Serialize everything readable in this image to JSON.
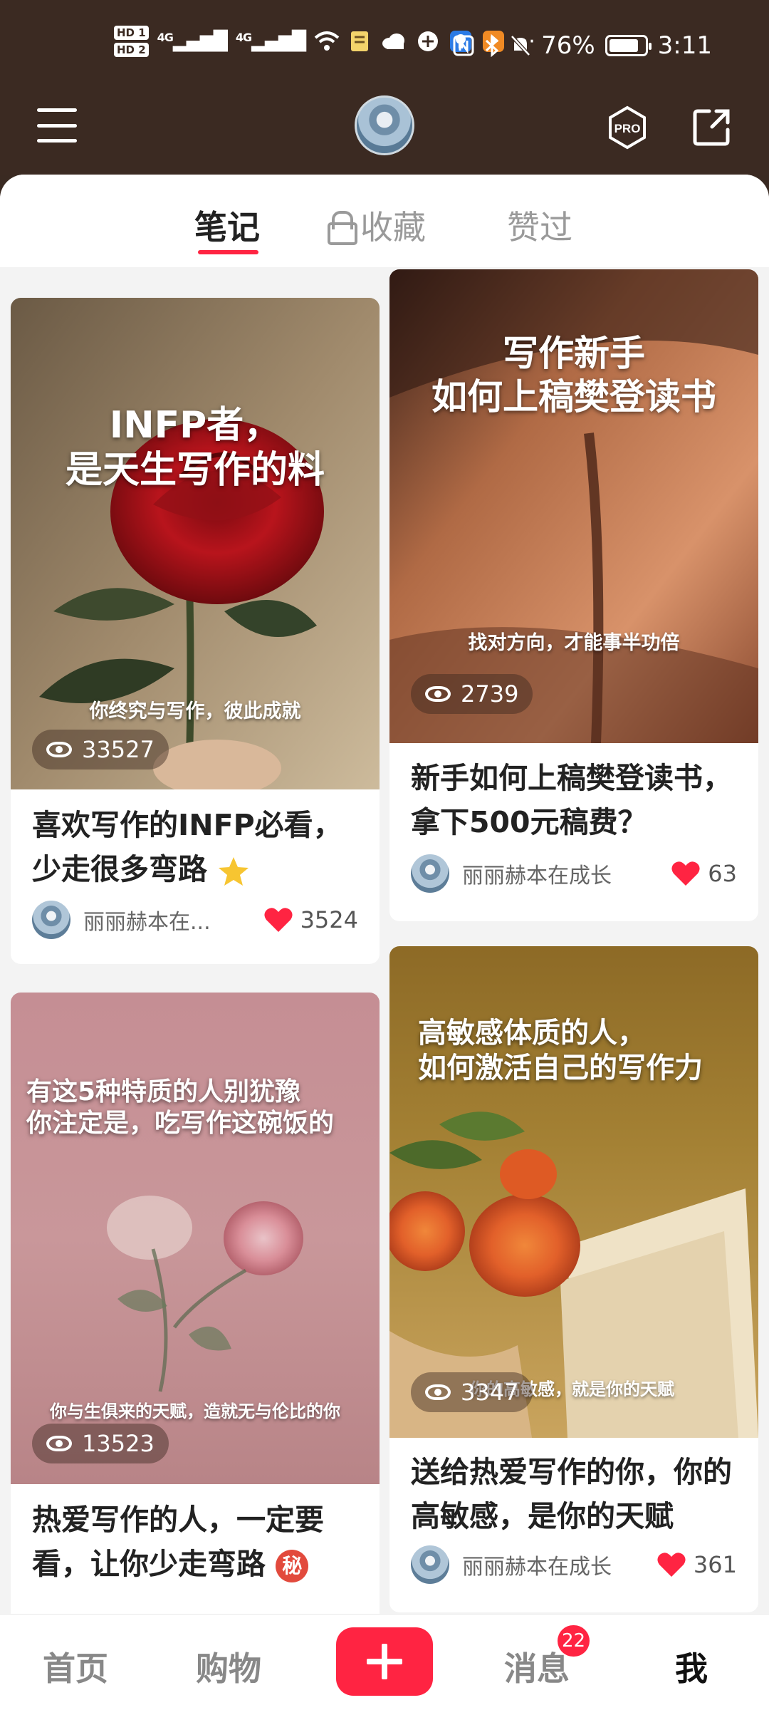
{
  "status_bar": {
    "hd1": "HD 1",
    "hd2": "HD 2",
    "signal1": "4G",
    "signal2": "4G",
    "dots": "···",
    "battery": "76%",
    "time": "3:11"
  },
  "header": {
    "pro_label": "PRO"
  },
  "tabs": [
    {
      "label": "笔记"
    },
    {
      "label": "收藏"
    },
    {
      "label": "赞过"
    }
  ],
  "notes": [
    {
      "cover_title": "INFP者，\n是天生写作的料",
      "cover_sub": "你终究与写作，彼此成就",
      "views": "33527",
      "title": "喜欢写作的INFP必看，少走很多弯路",
      "author": "丽丽赫本在...",
      "likes": "3524"
    },
    {
      "cover_title": "写作新手\n如何上稿樊登读书",
      "cover_sub": "找对方向，才能事半功倍",
      "views": "2739",
      "title": "新手如何上稿樊登读书，拿下500元稿费？",
      "author": "丽丽赫本在成长",
      "likes": "63"
    },
    {
      "cover_title": "有这5种特质的人别犹豫\n你注定是，吃写作这碗饭的",
      "cover_sub": "你与生俱来的天赋，造就无与伦比的你",
      "views": "13523",
      "title": "热爱写作的人，一定要看，让你少走弯路",
      "badge": "秘"
    },
    {
      "cover_title": "高敏感体质的人，\n如何激活自己的写作力",
      "cover_sub": "你的高敏感，就是你的天赋",
      "views": "3347",
      "title": "送给热爱写作的你，你的高敏感，是你的天赋",
      "author": "丽丽赫本在成长",
      "likes": "361"
    }
  ],
  "bottom_nav": [
    {
      "label": "首页"
    },
    {
      "label": "购物"
    },
    {
      "label": "消息",
      "badge": "22"
    },
    {
      "label": "我"
    }
  ],
  "colors": {
    "brand_red": "#ff2442",
    "header_bg": "#3b2a22"
  }
}
